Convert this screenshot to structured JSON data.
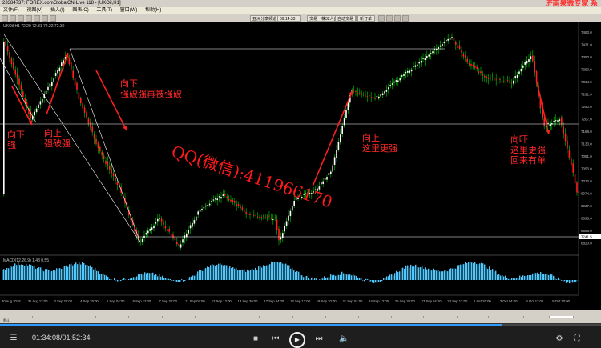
{
  "window": {
    "title": "23384737: FOREX.comGlobalCN-Live 118 - [UKOil,H1]",
    "watermark_brand": "济南泉微专家 系"
  },
  "menu": [
    "文件(F)",
    "视图(V)",
    "插入(I)",
    "图表(C)",
    "工具(T)",
    "窗口(W)",
    "帮助(H)"
  ],
  "toolbar": {
    "quote_field": "亚洲分享频道",
    "time_field": "09:14:33",
    "account_field": "交易一株32人正在观看",
    "auto_trade": "自动交易",
    "new_order": "新订单"
  },
  "chart": {
    "symbol_label": "UKOil,H1  72.29 72.31 72.22 72.30",
    "macd_label": "MACD(12,26,9) 1.43 0.55",
    "price_labels": [
      "7460.0",
      "7431.0",
      "7390.0",
      "7350.0",
      "7314.0",
      "7291.0",
      "7250.0",
      "7207.0",
      "7168.0",
      "7130.0",
      "7091.0",
      "7053.0",
      "7012.0",
      "6974.0",
      "6937.0",
      "6896.0",
      "6858.0",
      "6820.0"
    ],
    "current_price": "7241.5",
    "time_labels": [
      "30 Aug 2018",
      "31 Aug 12:00",
      "3 Sep 20:00",
      "4 Sep 20:00",
      "5 Sep 04:00",
      "6 Sep 12:00",
      "7 Sep 20:00",
      "11 Sep 04:00",
      "12 Sep 12:00",
      "13 Sep 20:00",
      "17 Sep 04:00",
      "18 Sep 12:00",
      "19 Sep 20:00",
      "21 Sep 04:00",
      "24 Sep 12:00",
      "25 Sep 20:00",
      "27 Sep 04:00",
      "28 Sep 12:00",
      "1 Oct 20:00",
      "3 Oct 04:00",
      "4 Oct 12:00",
      "5 Oct 20:00"
    ],
    "watermark": "QQ(微信):411966170",
    "colors": {
      "up": "#ffffff",
      "down": "#ff2020",
      "wick": "#00cc00",
      "macd": "#4fc8ff",
      "level": "#ffffff"
    }
  },
  "annotations": [
    {
      "id": "a1",
      "lines": [
        "向下",
        "强"
      ]
    },
    {
      "id": "a2",
      "lines": [
        "向上",
        "强破强"
      ]
    },
    {
      "id": "a3",
      "lines": [
        "向下",
        "强破强再被强破"
      ]
    },
    {
      "id": "a4",
      "lines": [
        "向上",
        "这里更强"
      ]
    },
    {
      "id": "a5",
      "lines": [
        "向吓",
        "这里更强",
        "回来有单"
      ]
    }
  ],
  "symbol_tabs": [
    "XAUUSD,M30",
    "US_OIL,M30",
    "EURUSD,M30",
    "GBPUSD,M30",
    "EURUSD,M30",
    "AUDUSD,M30",
    "NZDUSD,M30",
    "USDJPY,M30",
    "USDCHF,Daily",
    "GBPAUD,M30",
    "GBPNZD,M30",
    "GBPCAD,M30",
    "EURGBP,M30",
    "EURCAD,M30",
    "EURJPY,M30",
    "CHINA300,M30",
    "US30,M30",
    "UKOil,H1"
  ],
  "active_tab_index": 17,
  "status_text": "默认",
  "player": {
    "time": "01:34:08/01:52:34",
    "progress": 0.836
  }
}
